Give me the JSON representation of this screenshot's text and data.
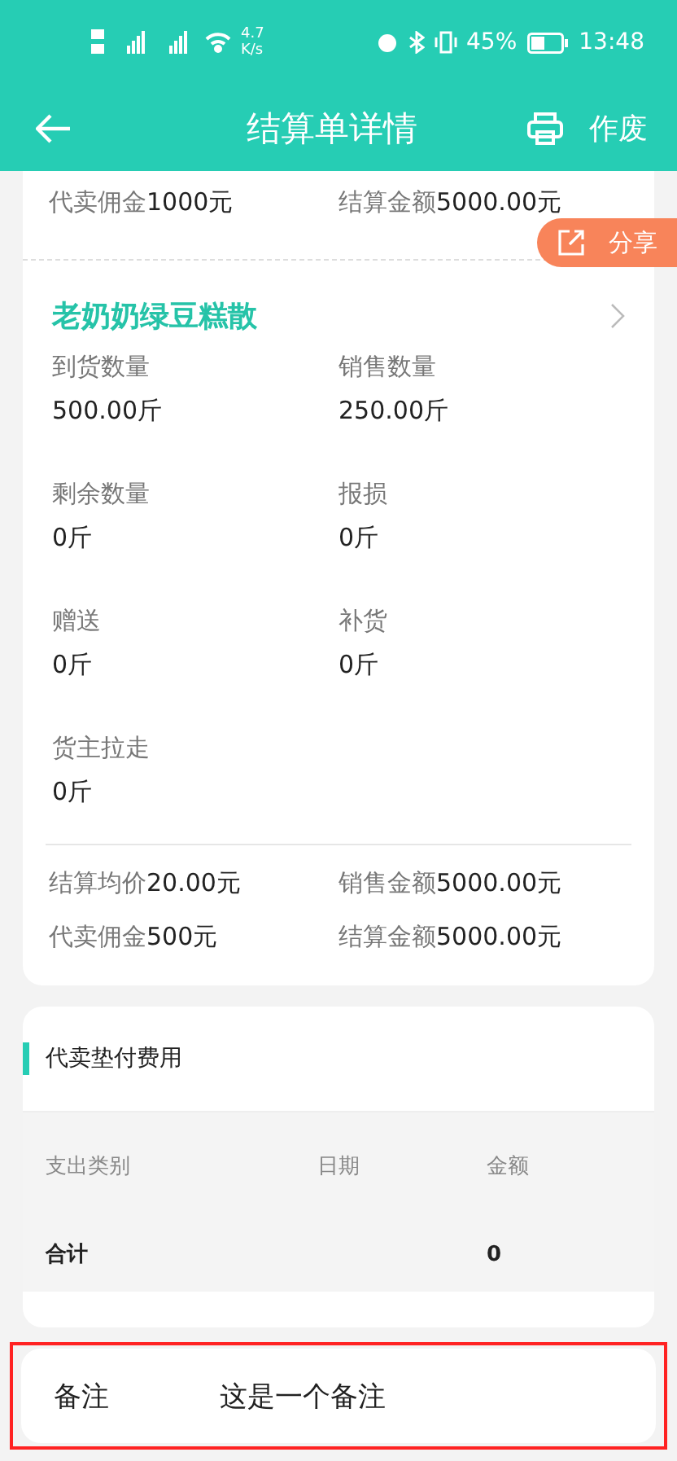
{
  "status_bar": {
    "speed": "4.7",
    "speed_unit": "K/s",
    "battery": "45%",
    "time": "13:48"
  },
  "header": {
    "title": "结算单详情",
    "action": "作废"
  },
  "share_button": {
    "label": "分享"
  },
  "previous_summary": [
    {
      "label": "代卖佣金",
      "value": "1000元"
    },
    {
      "label": "结算金额",
      "value": "5000.00元"
    }
  ],
  "product": {
    "name": "老奶奶绿豆糕散",
    "fields": [
      {
        "label": "到货数量",
        "value": "500.00斤"
      },
      {
        "label": "销售数量",
        "value": "250.00斤"
      },
      {
        "label": "剩余数量",
        "value": "0斤"
      },
      {
        "label": "报损",
        "value": "0斤"
      },
      {
        "label": "赠送",
        "value": "0斤"
      },
      {
        "label": "补货",
        "value": "0斤"
      },
      {
        "label": "货主拉走",
        "value": "0斤"
      }
    ],
    "summary": [
      {
        "label": "结算均价",
        "value": "20.00元"
      },
      {
        "label": "销售金额",
        "value": "5000.00元"
      },
      {
        "label": "代卖佣金",
        "value": "500元"
      },
      {
        "label": "结算金额",
        "value": "5000.00元"
      }
    ]
  },
  "expenses": {
    "title": "代卖垫付费用",
    "columns": [
      "支出类别",
      "日期",
      "金额"
    ],
    "total": {
      "label": "合计",
      "amount": "0"
    }
  },
  "remark": {
    "label": "备注",
    "value": "这是一个备注"
  }
}
